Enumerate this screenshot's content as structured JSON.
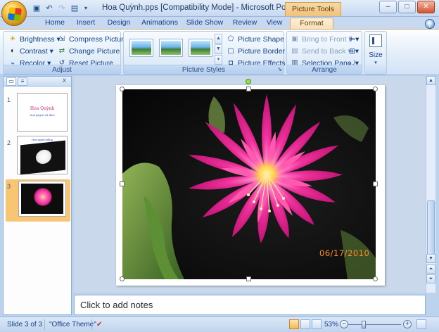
{
  "window": {
    "title": "Hoa Quỳnh.pps [Compatibility Mode] - Microsoft PowerPoint n...",
    "context_group": "Picture Tools",
    "controls": {
      "minimize": "–",
      "maximize": "□",
      "close": "✕"
    }
  },
  "qat": {
    "save_icon": "save-icon",
    "undo_icon": "undo-icon",
    "redo_icon": "redo-icon",
    "open_icon": "open-icon"
  },
  "tabs": [
    "Home",
    "Insert",
    "Design",
    "Animations",
    "Slide Show",
    "Review",
    "View",
    "Format"
  ],
  "active_tab": "Format",
  "help_label": "?",
  "ribbon": {
    "adjust": {
      "label": "Adjust",
      "brightness": "Brightness",
      "contrast": "Contrast",
      "recolor": "Recolor",
      "compress": "Compress Pictures",
      "change": "Change Picture",
      "reset": "Reset Picture"
    },
    "picture_styles": {
      "label": "Picture Styles",
      "shape": "Picture Shape",
      "border": "Picture Border",
      "effects": "Picture Effects"
    },
    "arrange": {
      "label": "Arrange",
      "bring_front": "Bring to Front",
      "send_back": "Send to Back",
      "selection_pane": "Selection Pane"
    },
    "size": {
      "label": "Size"
    }
  },
  "slides_panel": {
    "close": "x",
    "slides": [
      {
        "number": "1",
        "title": "Hoa Quỳnh",
        "subtitle": "Hoa Quỳnh nở đêm"
      },
      {
        "number": "2",
        "title": "Hoa quỳnh trắng"
      },
      {
        "number": "3"
      }
    ],
    "active_slide": 3
  },
  "slide": {
    "photo_date": "06/17/2010"
  },
  "notes": {
    "placeholder": "Click to add notes"
  },
  "status": {
    "slide_info": "Slide 3 of 3",
    "theme": "\"Office Theme\"",
    "zoom": "53%"
  },
  "colors": {
    "ribbon_blue": "#c6d9f1",
    "context_orange": "#f1c27a",
    "flower_magenta": "#e8288f",
    "date_orange": "#ff8a2a"
  }
}
